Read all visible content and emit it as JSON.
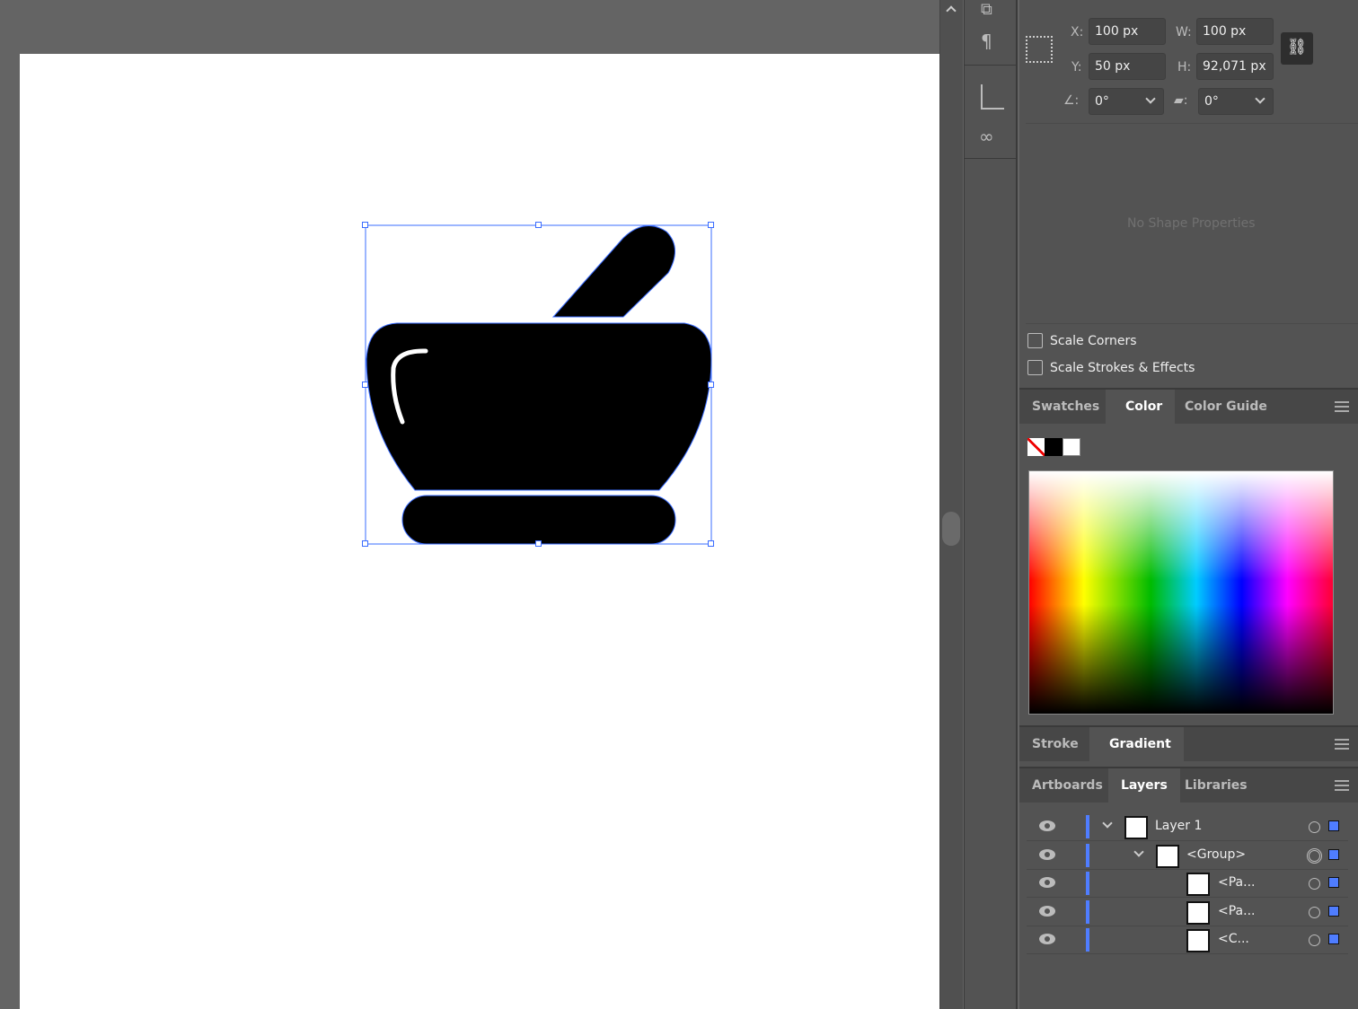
{
  "transform": {
    "x_label": "X:",
    "x": "100 px",
    "y_label": "Y:",
    "y": "50 px",
    "w_label": "W:",
    "w": "100 px",
    "h_label": "H:",
    "h": "92,071 px",
    "angle": "0°",
    "shear": "0°"
  },
  "shape": {
    "empty": "No Shape Properties"
  },
  "options": {
    "scale_corners": "Scale Corners",
    "scale_strokes": "Scale Strokes & Effects"
  },
  "color_tabs": [
    "Swatches",
    "Color",
    "Color Guide"
  ],
  "stroke_tabs": [
    "Stroke",
    "Gradient"
  ],
  "layer_tabs": [
    "Artboards",
    "Layers",
    "Libraries"
  ],
  "layers": [
    {
      "name": "Layer 1"
    },
    {
      "name": "<Group>"
    },
    {
      "name": "<Pa..."
    },
    {
      "name": "<Pa..."
    },
    {
      "name": "<C..."
    }
  ],
  "colors": {
    "selection": "#4f7dff",
    "panel": "#535353"
  }
}
